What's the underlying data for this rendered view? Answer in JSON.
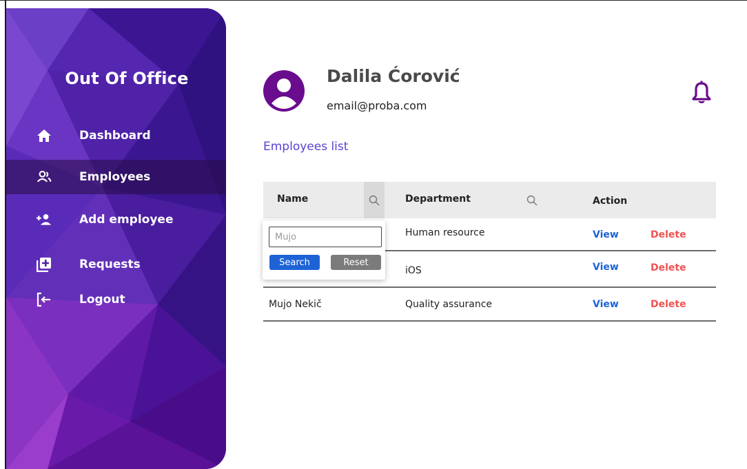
{
  "sidebar": {
    "app_title": "Out Of Office",
    "items": [
      {
        "label": "Dashboard",
        "icon": "home-icon",
        "active": false
      },
      {
        "label": "Employees",
        "icon": "users-icon",
        "active": true
      },
      {
        "label": "Add employee",
        "icon": "add-user-icon",
        "active": false
      },
      {
        "label": "Requests",
        "icon": "add-box-icon",
        "active": false
      },
      {
        "label": "Logout",
        "icon": "logout-icon",
        "active": false
      }
    ]
  },
  "user": {
    "name": "Dalila Ćorović",
    "email": "email@proba.com"
  },
  "main": {
    "section_title": "Employees list",
    "table": {
      "columns": {
        "name": "Name",
        "department": "Department",
        "action": "Action"
      },
      "rows": [
        {
          "name": "",
          "department": "Human resource",
          "view": "View",
          "delete": "Delete"
        },
        {
          "name": "",
          "department": "iOS",
          "view": "View",
          "delete": "Delete"
        },
        {
          "name": "Mujo Nekič",
          "department": "Quality assurance",
          "view": "View",
          "delete": "Delete"
        }
      ]
    },
    "filter": {
      "placeholder": "Mujo",
      "search_label": "Search",
      "reset_label": "Reset"
    }
  },
  "colors": {
    "sidebar_base": "#4a1fa0",
    "accent_purple": "#5b3fd4",
    "avatar_purple": "#6a0c8e",
    "view_link": "#1e63d6",
    "delete_link": "#ef5350"
  }
}
